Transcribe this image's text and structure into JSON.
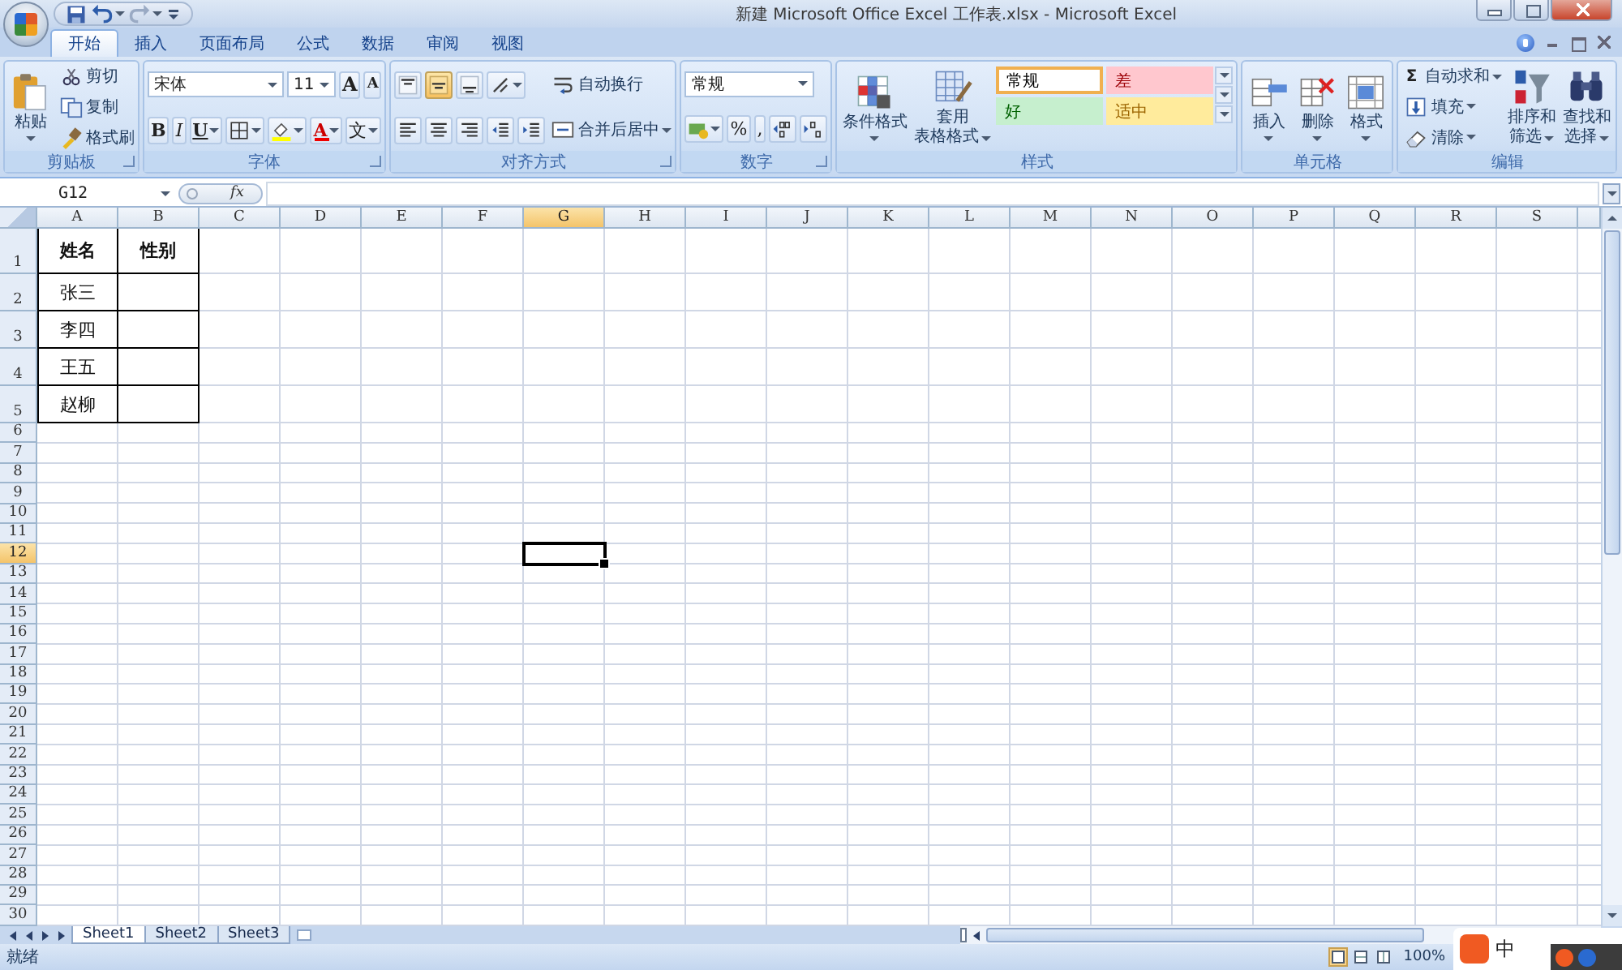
{
  "window": {
    "title": "新建 Microsoft Office Excel 工作表.xlsx - Microsoft Excel"
  },
  "quick_access": [
    {
      "kind": "save"
    },
    {
      "kind": "undo",
      "dropdown": true
    },
    {
      "kind": "redo",
      "dropdown": true
    },
    {
      "kind": "customize"
    }
  ],
  "ribbon_tabs": [
    {
      "label": "开始",
      "selected": true
    },
    {
      "label": "插入",
      "selected": false
    },
    {
      "label": "页面布局",
      "selected": false
    },
    {
      "label": "公式",
      "selected": false
    },
    {
      "label": "数据",
      "selected": false
    },
    {
      "label": "审阅",
      "selected": false
    },
    {
      "label": "视图",
      "selected": false
    }
  ],
  "ribbon": {
    "groups": [
      {
        "label": "剪贴板",
        "launcher": true,
        "columns": [
          [
            [
              {
                "kind": "paste",
                "lines": [
                  "粘贴"
                ],
                "dropdown": true
              }
            ]
          ],
          [
            [
              {
                "kind": "cut",
                "label": "剪切"
              }
            ],
            [
              {
                "kind": "copy",
                "label": "复制"
              }
            ],
            [
              {
                "kind": "brush",
                "label": "格式刷"
              }
            ]
          ]
        ]
      },
      {
        "label": "字体",
        "launcher": true,
        "columns": [
          [
            [
              {
                "kind": "font",
                "value": "宋体"
              },
              {
                "kind": "size",
                "value": "11"
              },
              {
                "kind": "grow",
                "glyph": "A"
              },
              {
                "kind": "shrink",
                "glyph": "A"
              }
            ],
            [
              {
                "kind": "bold",
                "glyph": "B"
              },
              {
                "kind": "italic",
                "glyph": "I"
              },
              {
                "kind": "underline",
                "glyph": "U",
                "dropdown": true
              },
              {
                "kind": "borders",
                "dropdown": true
              },
              {
                "kind": "fill",
                "dropdown": true
              },
              {
                "kind": "fontcolor",
                "glyph": "A",
                "dropdown": true
              },
              {
                "kind": "phonetic",
                "glyph": "文",
                "dropdown": true
              }
            ]
          ]
        ]
      },
      {
        "label": "对齐方式",
        "launcher": true,
        "columns": [
          [
            [
              {
                "kind": "top",
                "selected": false
              },
              {
                "kind": "middle",
                "selected": true
              },
              {
                "kind": "bottom",
                "selected": false
              },
              {
                "kind": "orient",
                "dropdown": true
              }
            ],
            [
              {
                "kind": "left",
                "selected": false
              },
              {
                "kind": "center",
                "selected": false
              },
              {
                "kind": "right",
                "selected": false
              },
              {
                "kind": "outdent"
              },
              {
                "kind": "indent"
              }
            ]
          ],
          [
            [
              {
                "kind": "wrap",
                "label": "自动换行"
              }
            ],
            [
              {
                "kind": "merge",
                "label": "合并后居中",
                "dropdown": true
              }
            ]
          ]
        ]
      },
      {
        "label": "数字",
        "launcher": true,
        "columns": [
          [
            [
              {
                "kind": "numfmt",
                "value": "常规"
              }
            ],
            [
              {
                "kind": "currency",
                "dropdown": true
              },
              {
                "kind": "percent",
                "glyph": "%"
              },
              {
                "kind": "comma",
                "glyph": ","
              },
              {
                "kind": "incdec"
              },
              {
                "kind": "decdec"
              }
            ]
          ]
        ]
      },
      {
        "label": "样式",
        "columns": [
          [
            [
              {
                "kind": "condfmt",
                "lines": [
                  "条件格式"
                ],
                "dropdown": true
              }
            ]
          ],
          [
            [
              {
                "kind": "tablefmt",
                "lines": [
                  "套用",
                  "表格格式"
                ],
                "dropdown": true
              }
            ]
          ]
        ],
        "gallery": [
          {
            "label": "常规",
            "kind": "normal",
            "selected": true,
            "color": "#ffffff"
          },
          {
            "label": "差",
            "kind": "bad",
            "selected": false,
            "color": "#ffc7ce"
          },
          {
            "label": "好",
            "kind": "good",
            "selected": false,
            "color": "#c6efce"
          },
          {
            "label": "适中",
            "kind": "neutral",
            "selected": false,
            "color": "#ffeb9c"
          }
        ]
      },
      {
        "label": "单元格",
        "columns": [
          [
            [
              {
                "kind": "insertcell",
                "lines": [
                  "插入"
                ],
                "dropdown": true
              }
            ]
          ],
          [
            [
              {
                "kind": "deletecell",
                "lines": [
                  "删除"
                ],
                "dropdown": true
              }
            ]
          ],
          [
            [
              {
                "kind": "formatcell",
                "lines": [
                  "格式"
                ],
                "dropdown": true
              }
            ]
          ]
        ]
      },
      {
        "label": "编辑",
        "columns": [
          [
            [
              {
                "kind": "sum",
                "glyph": "Σ",
                "label": "自动求和",
                "dropdown": true
              }
            ],
            [
              {
                "kind": "filldown",
                "label": "填充",
                "dropdown": true
              }
            ],
            [
              {
                "kind": "eraser",
                "label": "清除",
                "dropdown": true
              }
            ]
          ],
          [
            [
              {
                "kind": "sort",
                "lines": [
                  "排序和",
                  "筛选"
                ],
                "dropdown": true
              }
            ]
          ],
          [
            [
              {
                "kind": "find",
                "lines": [
                  "查找和",
                  "选择"
                ],
                "dropdown": true
              }
            ]
          ]
        ]
      }
    ]
  },
  "formula_bar": {
    "name_box": "G12",
    "function_label": "fx"
  },
  "sheet": {
    "columns": [
      {
        "label": "A",
        "selected": false
      },
      {
        "label": "B",
        "selected": false
      },
      {
        "label": "C",
        "selected": false
      },
      {
        "label": "D",
        "selected": false
      },
      {
        "label": "E",
        "selected": false
      },
      {
        "label": "F",
        "selected": false
      },
      {
        "label": "G",
        "selected": true
      },
      {
        "label": "H",
        "selected": false
      },
      {
        "label": "I",
        "selected": false
      },
      {
        "label": "J",
        "selected": false
      },
      {
        "label": "K",
        "selected": false
      },
      {
        "label": "L",
        "selected": false
      },
      {
        "label": "M",
        "selected": false
      },
      {
        "label": "N",
        "selected": false
      },
      {
        "label": "O",
        "selected": false
      },
      {
        "label": "P",
        "selected": false
      },
      {
        "label": "Q",
        "selected": false
      },
      {
        "label": "R",
        "selected": false
      },
      {
        "label": "S",
        "selected": false
      }
    ],
    "rows": [
      {
        "label": "1",
        "selected": false,
        "cells": [
          {
            "text": "姓名",
            "bold": true,
            "bordered": true
          },
          {
            "text": "性别",
            "bold": true,
            "bordered": true
          }
        ]
      },
      {
        "label": "2",
        "selected": false,
        "cells": [
          {
            "text": "张三",
            "bold": false,
            "bordered": true
          },
          {
            "bold": false,
            "bordered": true
          }
        ]
      },
      {
        "label": "3",
        "selected": false,
        "cells": [
          {
            "text": "李四",
            "bold": false,
            "bordered": true
          },
          {
            "bold": false,
            "bordered": true
          }
        ]
      },
      {
        "label": "4",
        "selected": false,
        "cells": [
          {
            "text": "王五",
            "bold": false,
            "bordered": true
          },
          {
            "bold": false,
            "bordered": true
          }
        ]
      },
      {
        "label": "5",
        "selected": false,
        "cells": [
          {
            "text": "赵柳",
            "bold": false,
            "bordered": true
          },
          {
            "bold": false,
            "bordered": true
          }
        ]
      },
      {
        "label": "6",
        "selected": false
      },
      {
        "label": "7",
        "selected": false
      },
      {
        "label": "8",
        "selected": false
      },
      {
        "label": "9",
        "selected": false
      },
      {
        "label": "10",
        "selected": false
      },
      {
        "label": "11",
        "selected": false
      },
      {
        "label": "12",
        "selected": true
      },
      {
        "label": "13",
        "selected": false
      },
      {
        "label": "14",
        "selected": false
      },
      {
        "label": "15",
        "selected": false
      },
      {
        "label": "16",
        "selected": false
      },
      {
        "label": "17",
        "selected": false
      },
      {
        "label": "18",
        "selected": false
      },
      {
        "label": "19",
        "selected": false
      },
      {
        "label": "20",
        "selected": false
      },
      {
        "label": "21",
        "selected": false
      },
      {
        "label": "22",
        "selected": false
      },
      {
        "label": "23",
        "selected": false
      },
      {
        "label": "24",
        "selected": false
      },
      {
        "label": "25",
        "selected": false
      },
      {
        "label": "26",
        "selected": false
      },
      {
        "label": "27",
        "selected": false
      },
      {
        "label": "28",
        "selected": false
      },
      {
        "label": "29",
        "selected": false
      },
      {
        "label": "30",
        "selected": false
      }
    ]
  },
  "sheet_tabs": [
    {
      "label": "Sheet1",
      "selected": true
    },
    {
      "label": "Sheet2",
      "selected": false
    },
    {
      "label": "Sheet3",
      "selected": false
    }
  ],
  "status_bar": {
    "text": "就绪",
    "views": [
      {
        "kind": "normal",
        "selected": true
      },
      {
        "kind": "layout",
        "selected": false
      },
      {
        "kind": "pagebreak",
        "selected": false
      }
    ],
    "zoom": "100%"
  },
  "ime_bar": {
    "label": "中"
  }
}
